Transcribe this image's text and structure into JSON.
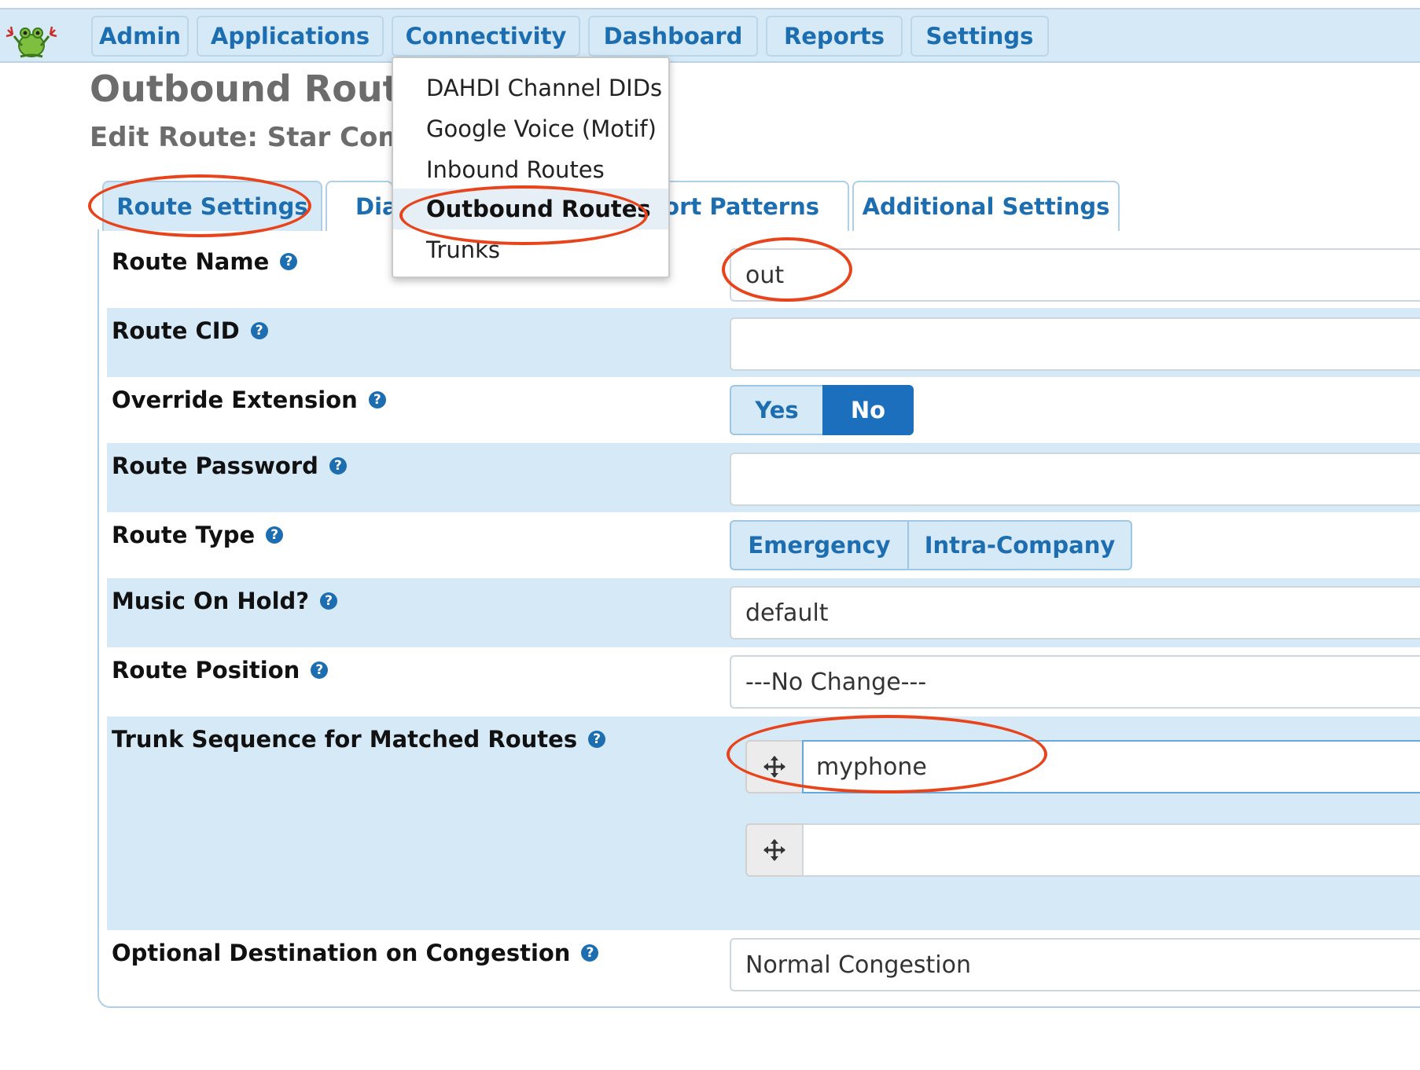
{
  "nav": {
    "items": [
      "Admin",
      "Applications",
      "Connectivity",
      "Dashboard",
      "Reports",
      "Settings"
    ]
  },
  "page": {
    "title": "Outbound Routes",
    "subtitle": "Edit Route: Star Commu"
  },
  "tabs": [
    "Route Settings",
    "Dia",
    "xport Patterns",
    "Additional Settings"
  ],
  "dropdown": {
    "items": [
      "DAHDI Channel DIDs",
      "Google Voice (Motif)",
      "Inbound Routes",
      "Outbound Routes",
      "Trunks"
    ],
    "selected": "Outbound Routes"
  },
  "form": {
    "route_name": {
      "label": "Route Name",
      "value": "out"
    },
    "route_cid": {
      "label": "Route CID",
      "value": ""
    },
    "override_extension": {
      "label": "Override Extension",
      "options": [
        "Yes",
        "No"
      ],
      "selected": "No"
    },
    "route_password": {
      "label": "Route Password",
      "value": ""
    },
    "route_type": {
      "label": "Route Type",
      "options": [
        "Emergency",
        "Intra-Company"
      ]
    },
    "music_on_hold": {
      "label": "Music On Hold?",
      "value": "default"
    },
    "route_position": {
      "label": "Route Position",
      "value": "---No Change---"
    },
    "trunk_sequence": {
      "label": "Trunk Sequence for Matched Routes",
      "trunks": [
        "myphone",
        ""
      ]
    },
    "congestion": {
      "label": "Optional Destination on Congestion",
      "value": "Normal Congestion"
    }
  },
  "help_glyph": "?",
  "colors": {
    "accent": "#1d6eb0",
    "nav_bg": "#d6e9f7",
    "selected_segment": "#1b6fbd",
    "annotation": "#e8441c"
  }
}
